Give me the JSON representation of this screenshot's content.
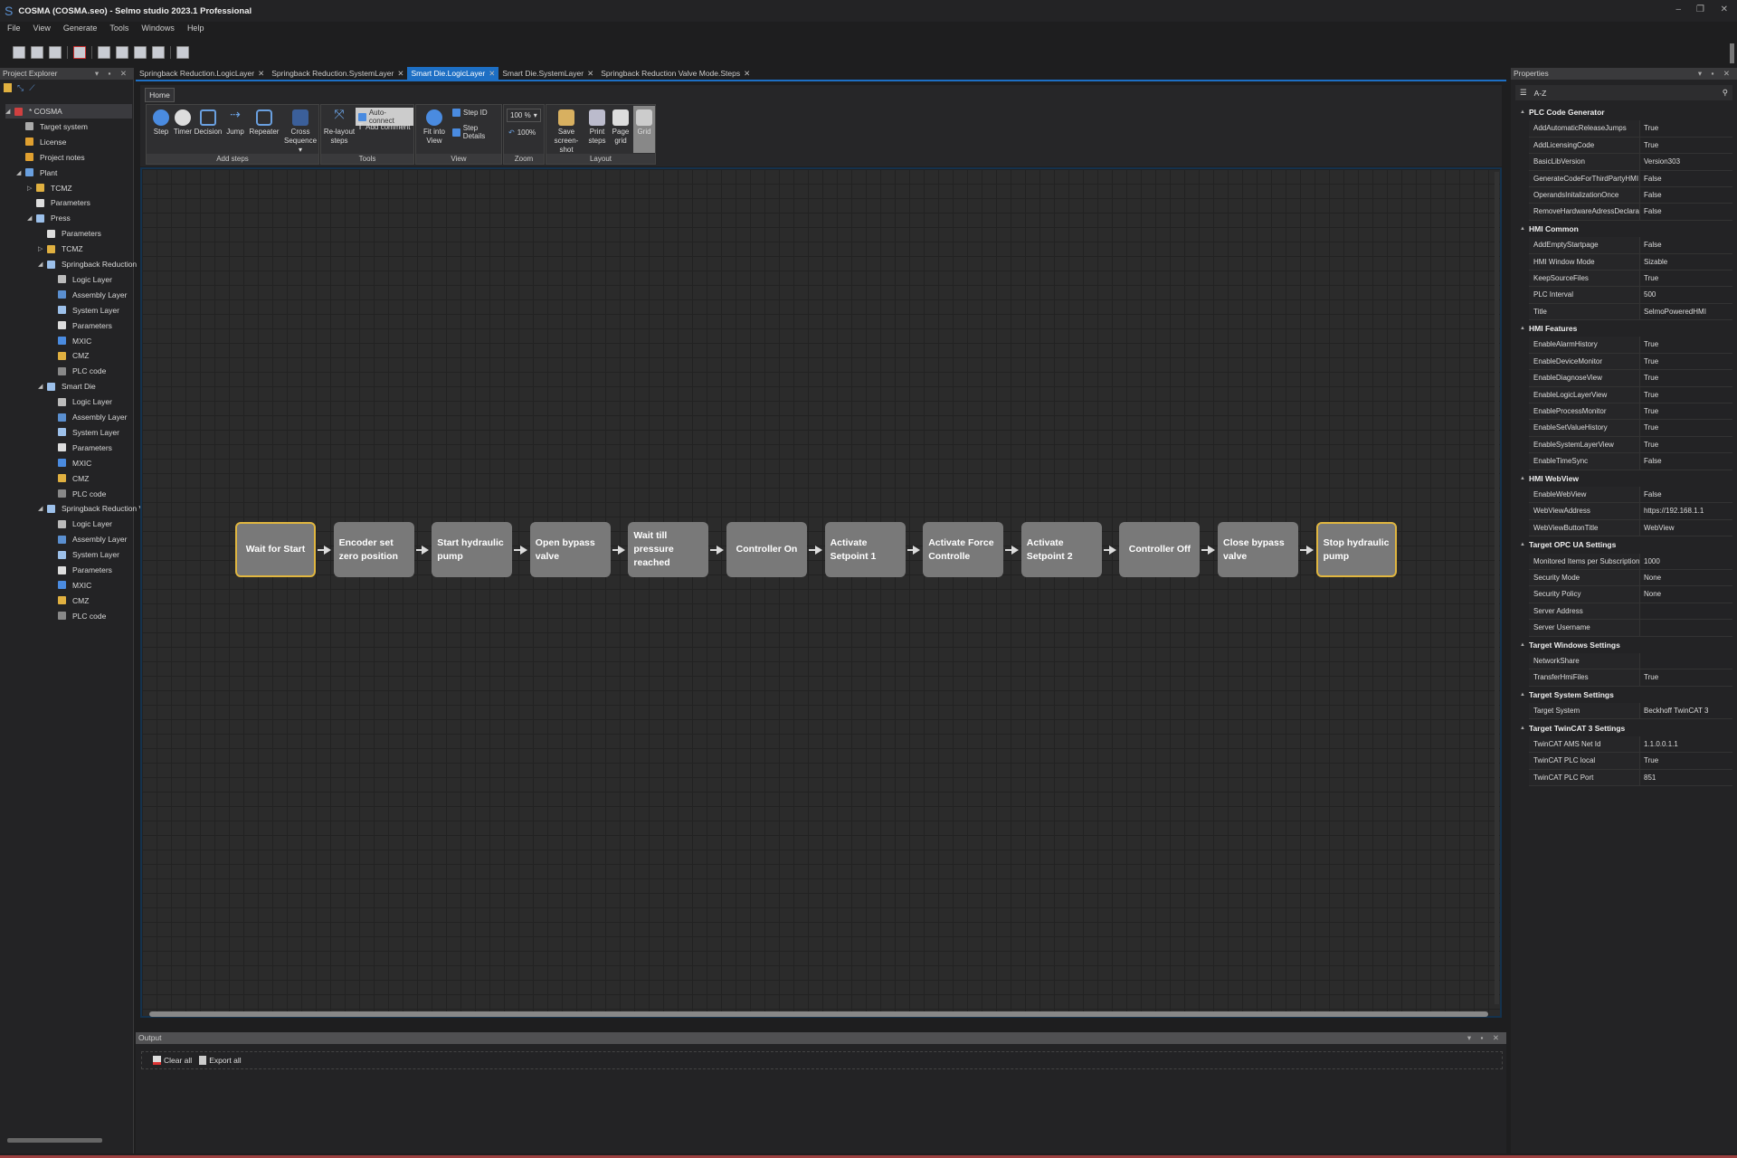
{
  "window": {
    "title": "COSMA (COSMA.seo) - Selmo studio 2023.1 Professional",
    "logo": "S"
  },
  "menu": [
    "File",
    "View",
    "Generate",
    "Tools",
    "Windows",
    "Help"
  ],
  "project_explorer": {
    "title": "Project Explorer",
    "tree": [
      {
        "label": "* COSMA",
        "level": 0,
        "exp": "open",
        "icon": "project-icon",
        "color": "#d04040"
      },
      {
        "label": "Target system",
        "level": 1,
        "icon": "target-system-icon",
        "color": "#aaa"
      },
      {
        "label": "License",
        "level": 1,
        "icon": "key-icon",
        "color": "#e0a030"
      },
      {
        "label": "Project notes",
        "level": 1,
        "icon": "notes-icon",
        "color": "#e0a030"
      },
      {
        "label": "Plant",
        "level": 1,
        "exp": "open",
        "icon": "plant-icon",
        "color": "#6aa0e0"
      },
      {
        "label": "TCMZ",
        "level": 2,
        "exp": "closed",
        "icon": "folder-icon",
        "color": "#e0b040"
      },
      {
        "label": "Parameters",
        "level": 2,
        "icon": "parameters-icon",
        "color": "#ddd"
      },
      {
        "label": "Press",
        "level": 2,
        "exp": "open",
        "icon": "cube-icon",
        "color": "#9cc0ea"
      },
      {
        "label": "Parameters",
        "level": 3,
        "icon": "parameters-icon",
        "color": "#ddd"
      },
      {
        "label": "TCMZ",
        "level": 3,
        "exp": "closed",
        "icon": "folder-icon",
        "color": "#e0b040"
      },
      {
        "label": "Springback Reduction",
        "level": 3,
        "exp": "open",
        "icon": "cube-icon",
        "color": "#9cc0ea"
      },
      {
        "label": "Logic Layer",
        "level": 4,
        "icon": "logic-layer-icon",
        "color": "#bbb"
      },
      {
        "label": "Assembly Layer",
        "level": 4,
        "icon": "assembly-layer-icon",
        "color": "#5a8fd0"
      },
      {
        "label": "System Layer",
        "level": 4,
        "icon": "system-layer-icon",
        "color": "#9cc0ea"
      },
      {
        "label": "Parameters",
        "level": 4,
        "icon": "parameters-icon",
        "color": "#ddd"
      },
      {
        "label": "MXIC",
        "level": 4,
        "icon": "mxic-icon",
        "color": "#4a8be0"
      },
      {
        "label": "CMZ",
        "level": 4,
        "icon": "cmz-icon",
        "color": "#e0b040"
      },
      {
        "label": "PLC code",
        "level": 4,
        "icon": "plc-code-icon",
        "color": "#888"
      },
      {
        "label": "Smart Die",
        "level": 3,
        "exp": "open",
        "icon": "cube-icon",
        "color": "#9cc0ea"
      },
      {
        "label": "Logic Layer",
        "level": 4,
        "icon": "logic-layer-icon",
        "color": "#bbb"
      },
      {
        "label": "Assembly Layer",
        "level": 4,
        "icon": "assembly-layer-icon",
        "color": "#5a8fd0"
      },
      {
        "label": "System Layer",
        "level": 4,
        "icon": "system-layer-icon",
        "color": "#9cc0ea"
      },
      {
        "label": "Parameters",
        "level": 4,
        "icon": "parameters-icon",
        "color": "#ddd"
      },
      {
        "label": "MXIC",
        "level": 4,
        "icon": "mxic-icon",
        "color": "#4a8be0"
      },
      {
        "label": "CMZ",
        "level": 4,
        "icon": "cmz-icon",
        "color": "#e0b040"
      },
      {
        "label": "PLC code",
        "level": 4,
        "icon": "plc-code-icon",
        "color": "#888"
      },
      {
        "label": "Springback Reduction V",
        "level": 3,
        "exp": "open",
        "icon": "cube-icon",
        "color": "#9cc0ea"
      },
      {
        "label": "Logic Layer",
        "level": 4,
        "icon": "logic-layer-icon",
        "color": "#bbb"
      },
      {
        "label": "Assembly Layer",
        "level": 4,
        "icon": "assembly-layer-icon",
        "color": "#5a8fd0"
      },
      {
        "label": "System Layer",
        "level": 4,
        "icon": "system-layer-icon",
        "color": "#9cc0ea"
      },
      {
        "label": "Parameters",
        "level": 4,
        "icon": "parameters-icon",
        "color": "#ddd"
      },
      {
        "label": "MXIC",
        "level": 4,
        "icon": "mxic-icon",
        "color": "#4a8be0"
      },
      {
        "label": "CMZ",
        "level": 4,
        "icon": "cmz-icon",
        "color": "#e0b040"
      },
      {
        "label": "PLC code",
        "level": 4,
        "icon": "plc-code-icon",
        "color": "#888"
      }
    ]
  },
  "tabs": [
    {
      "label": "Springback Reduction.LogicLayer"
    },
    {
      "label": "Springback Reduction.SystemLayer"
    },
    {
      "label": "Smart Die.LogicLayer",
      "active": true
    },
    {
      "label": "Smart Die.SystemLayer"
    },
    {
      "label": "Springback Reduction Valve Mode.Steps"
    }
  ],
  "ribbon": {
    "home_tab": "Home",
    "groups": {
      "add_steps": "Add steps",
      "tools": "Tools",
      "view": "View",
      "zoom": "Zoom",
      "layout": "Layout"
    },
    "step": "Step",
    "timer": "Timer",
    "decision": "Decision",
    "jump": "Jump",
    "repeater": "Repeater",
    "cross_sequence": "Cross Sequence ▾",
    "relayout": "Re-layout steps",
    "auto_connect": "Auto-connect",
    "add_comment": "Add comment",
    "fit": "Fit into View",
    "step_id": "Step ID",
    "step_details": "Step Details",
    "zoom_value": "100 %",
    "zoom_reset": "100%",
    "save_screenshot": "Save screen-shot",
    "print_steps": "Print steps",
    "page_grid": "Page grid",
    "grid": "Grid"
  },
  "flow": {
    "steps": [
      {
        "label": "Wait for Start",
        "selected": true,
        "center": true
      },
      {
        "label": "Encoder set zero position"
      },
      {
        "label": "Start hydraulic pump"
      },
      {
        "label": "Open bypass valve"
      },
      {
        "label": "Wait till pressure reached"
      },
      {
        "label": "Controller On",
        "center": true
      },
      {
        "label": "Activate Setpoint 1"
      },
      {
        "label": "Activate Force Controlle"
      },
      {
        "label": "Activate Setpoint 2"
      },
      {
        "label": "Controller Off",
        "center": true
      },
      {
        "label": "Close bypass valve"
      },
      {
        "label": "Stop hydraulic pump",
        "selected": true
      }
    ],
    "selected_color": "#e0b640",
    "step_color": "#797979"
  },
  "output": {
    "title": "Output",
    "clear_all": "Clear all",
    "export_all": "Export all"
  },
  "properties": {
    "title": "Properties",
    "sort_label": "A-Z",
    "categories": [
      {
        "name": "PLC Code Generator",
        "rows": [
          [
            "AddAutomaticReleaseJumps",
            "True"
          ],
          [
            "AddLicensingCode",
            "True"
          ],
          [
            "BasicLibVersion",
            "Version303"
          ],
          [
            "GenerateCodeForThirdPartyHMI",
            "False"
          ],
          [
            "OperandsInitalizationOnce",
            "False"
          ],
          [
            "RemoveHardwareAdressDeclarations",
            "False"
          ]
        ]
      },
      {
        "name": "HMI Common",
        "rows": [
          [
            "AddEmptyStartpage",
            "False"
          ],
          [
            "HMI Window Mode",
            "Sizable"
          ],
          [
            "KeepSourceFiles",
            "True"
          ],
          [
            "PLC Interval",
            "500"
          ],
          [
            "Title",
            "SelmoPoweredHMI"
          ]
        ]
      },
      {
        "name": "HMI Features",
        "rows": [
          [
            "EnableAlarmHistory",
            "True"
          ],
          [
            "EnableDeviceMonitor",
            "True"
          ],
          [
            "EnableDiagnoseView",
            "True"
          ],
          [
            "EnableLogicLayerView",
            "True"
          ],
          [
            "EnableProcessMonitor",
            "True"
          ],
          [
            "EnableSetValueHistory",
            "True"
          ],
          [
            "EnableSystemLayerView",
            "True"
          ],
          [
            "EnableTimeSync",
            "False"
          ]
        ]
      },
      {
        "name": "HMI WebView",
        "rows": [
          [
            "EnableWebView",
            "False"
          ],
          [
            "WebViewAddress",
            "https://192.168.1.1"
          ],
          [
            "WebViewButtonTitle",
            "WebView"
          ]
        ]
      },
      {
        "name": "Target OPC UA Settings",
        "rows": [
          [
            "Monitored Items per Subscription",
            "1000"
          ],
          [
            "Security Mode",
            "None"
          ],
          [
            "Security Policy",
            "None"
          ],
          [
            "Server Address",
            ""
          ],
          [
            "Server Username",
            ""
          ]
        ]
      },
      {
        "name": "Target Windows Settings",
        "rows": [
          [
            "NetworkShare",
            ""
          ],
          [
            "TransferHmiFiles",
            "True"
          ]
        ]
      },
      {
        "name": "Target System Settings",
        "rows": [
          [
            "Target System",
            "Beckhoff TwinCAT 3"
          ]
        ]
      },
      {
        "name": "Target TwinCAT 3 Settings",
        "rows": [
          [
            "TwinCAT AMS Net Id",
            "1.1.0.0.1.1"
          ],
          [
            "TwinCAT PLC local",
            "True"
          ],
          [
            "TwinCAT PLC Port",
            "851"
          ]
        ]
      }
    ]
  }
}
